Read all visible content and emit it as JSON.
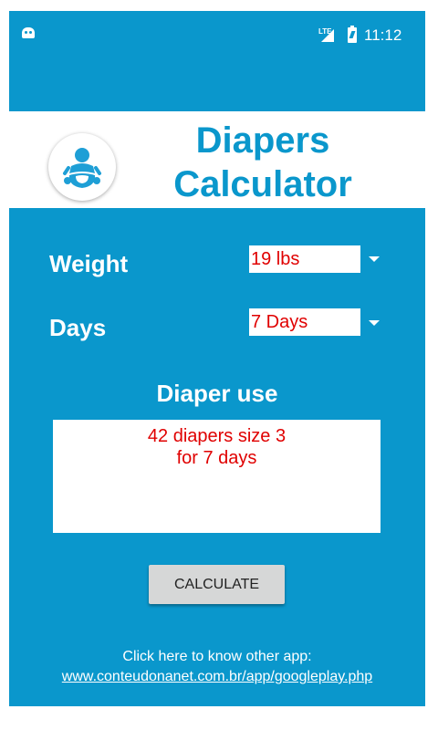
{
  "status_bar": {
    "network": "LTE",
    "time": "11:12"
  },
  "header": {
    "logo_icon": "baby-icon",
    "title_line1": "Diapers",
    "title_line2": "Calculator"
  },
  "form": {
    "weight_label": "Weight",
    "weight_value": "19 lbs",
    "days_label": "Days",
    "days_value": "7 Days"
  },
  "result": {
    "heading": "Diaper use",
    "line1": "42 diapers size 3",
    "line2": "for 7 days"
  },
  "actions": {
    "calculate_label": "CALCULATE"
  },
  "footer": {
    "text": "Click here to know other app:",
    "link": "www.conteudonanet.com.br/app/googleplay.php"
  },
  "colors": {
    "background": "#0a97cc",
    "title": "#0a97cc",
    "value_text": "#e00000",
    "button": "#d6d7d7"
  }
}
